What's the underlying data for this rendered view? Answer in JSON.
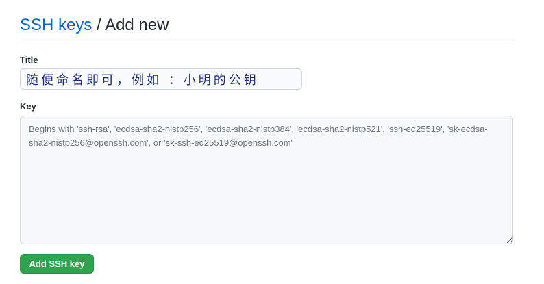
{
  "header": {
    "breadcrumb_link": "SSH keys",
    "separator": " / ",
    "current": "Add new"
  },
  "form": {
    "title_label": "Title",
    "title_value": "随便命名即可，例如 ：小明的公钥",
    "key_label": "Key",
    "key_placeholder": "Begins with 'ssh-rsa', 'ecdsa-sha2-nistp256', 'ecdsa-sha2-nistp384', 'ecdsa-sha2-nistp521', 'ssh-ed25519', 'sk-ecdsa-sha2-nistp256@openssh.com', or 'sk-ssh-ed25519@openssh.com'",
    "submit_label": "Add SSH key"
  },
  "colors": {
    "link": "#0366d6",
    "button_bg": "#2ea44f",
    "title_text": "#1a2a8c"
  }
}
